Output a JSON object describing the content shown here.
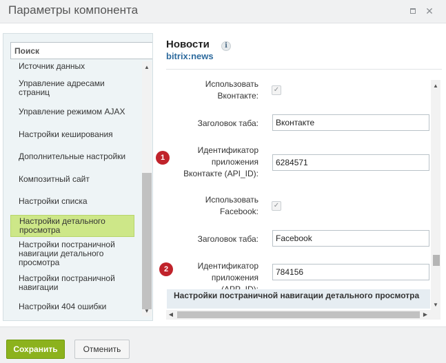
{
  "window": {
    "title": "Параметры компонента"
  },
  "sidebar": {
    "search_placeholder": "Поиск",
    "items": [
      {
        "label": "Источник данных"
      },
      {
        "label": "Управление адресами страниц"
      },
      {
        "label": "Управление режимом AJAX"
      },
      {
        "label": "Настройки кеширования"
      },
      {
        "label": "Дополнительные настройки"
      },
      {
        "label": "Композитный сайт"
      },
      {
        "label": "Настройки списка"
      },
      {
        "label": "Настройки детального просмотра",
        "active": true
      },
      {
        "label": "Настройки постраничной навигации детального просмотра"
      },
      {
        "label": "Настройки постраничной навигации"
      },
      {
        "label": "Настройки 404 ошибки"
      }
    ]
  },
  "component": {
    "title": "Новости",
    "code": "bitrix:news",
    "info_icon": "i"
  },
  "form": {
    "use_vk_label": "Использовать Вконтакте:",
    "use_vk_checked": true,
    "vk_tab_label": "Заголовок таба:",
    "vk_tab_value": "Вконтакте",
    "vk_app_label": "Идентификатор приложения Вконтакте (API_ID):",
    "vk_app_value": "6284571",
    "use_fb_label": "Использовать Facebook:",
    "use_fb_checked": true,
    "fb_tab_label": "Заголовок таба:",
    "fb_tab_value": "Facebook",
    "fb_app_label": "Идентификатор приложения (APP_ID):",
    "fb_app_value": "784156",
    "section_title": "Настройки постраничной навигации детального просмотра",
    "badge_1": "1",
    "badge_2": "2"
  },
  "footer": {
    "save_label": "Сохранить",
    "cancel_label": "Отменить"
  },
  "colors": {
    "accent_green": "#8cb21d",
    "active_item": "#cde788",
    "badge_red": "#c0232b",
    "link_blue": "#2e6b9e"
  }
}
